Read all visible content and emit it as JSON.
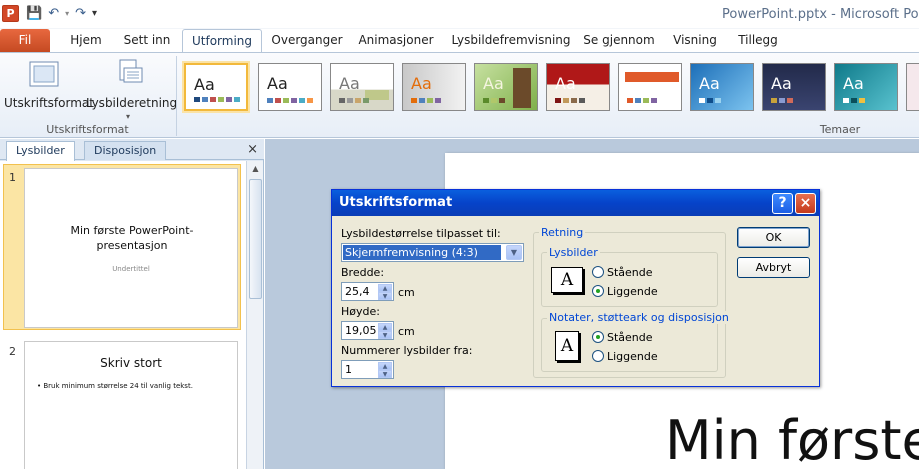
{
  "app": {
    "window_title": "PowerPoint.pptx - Microsoft Powe",
    "app_icon_letter": "P"
  },
  "ribbon_tabs": [
    "Fil",
    "Hjem",
    "Sett inn",
    "Utforming",
    "Overganger",
    "Animasjoner",
    "Lysbildefremvisning",
    "Se gjennom",
    "Visning",
    "Tillegg"
  ],
  "active_tab": "Utforming",
  "ribbon": {
    "page_setup_label": "Utskriftsformat",
    "orientation_label": "Lysbilderetning",
    "group_page_setup": "Utskriftsformat",
    "group_themes": "Temaer",
    "theme_sample_text": "Aa"
  },
  "pane": {
    "tab_slides": "Lysbilder",
    "tab_outline": "Disposisjon",
    "close_symbol": "×"
  },
  "slides": [
    {
      "number": "1",
      "title": "Min første PowerPoint-presentasjon",
      "subtitle": "Undertittel"
    },
    {
      "number": "2",
      "title": "Skriv stort",
      "bullet": "Bruk minimum størrelse 24 til vanlig tekst."
    }
  ],
  "editor": {
    "visible_title_text": "Min første"
  },
  "dialog": {
    "title": "Utskriftsformat",
    "size_label": "Lysbildestørrelse tilpasset til:",
    "size_value": "Skjermfremvisning (4:3)",
    "width_label": "Bredde:",
    "width_value": "25,4",
    "width_unit": "cm",
    "height_label": "Høyde:",
    "height_value": "19,05",
    "height_unit": "cm",
    "number_from_label": "Nummerer lysbilder fra:",
    "number_from_value": "1",
    "orientation_group": "Retning",
    "slides_group": "Lysbilder",
    "slides_portrait": "Stående",
    "slides_landscape": "Liggende",
    "slides_selected": "Liggende",
    "notes_group": "Notater, støtteark og disposisjon",
    "notes_portrait": "Stående",
    "notes_landscape": "Liggende",
    "notes_selected": "Stående",
    "ok_label": "OK",
    "cancel_label": "Avbryt",
    "help_symbol": "?",
    "close_symbol": "×",
    "page_icon_letter": "A"
  },
  "colors": {
    "file_tab": "#d24726",
    "dialog_title": "#0a5fde",
    "selected_highlight": "#fbe5a4"
  }
}
